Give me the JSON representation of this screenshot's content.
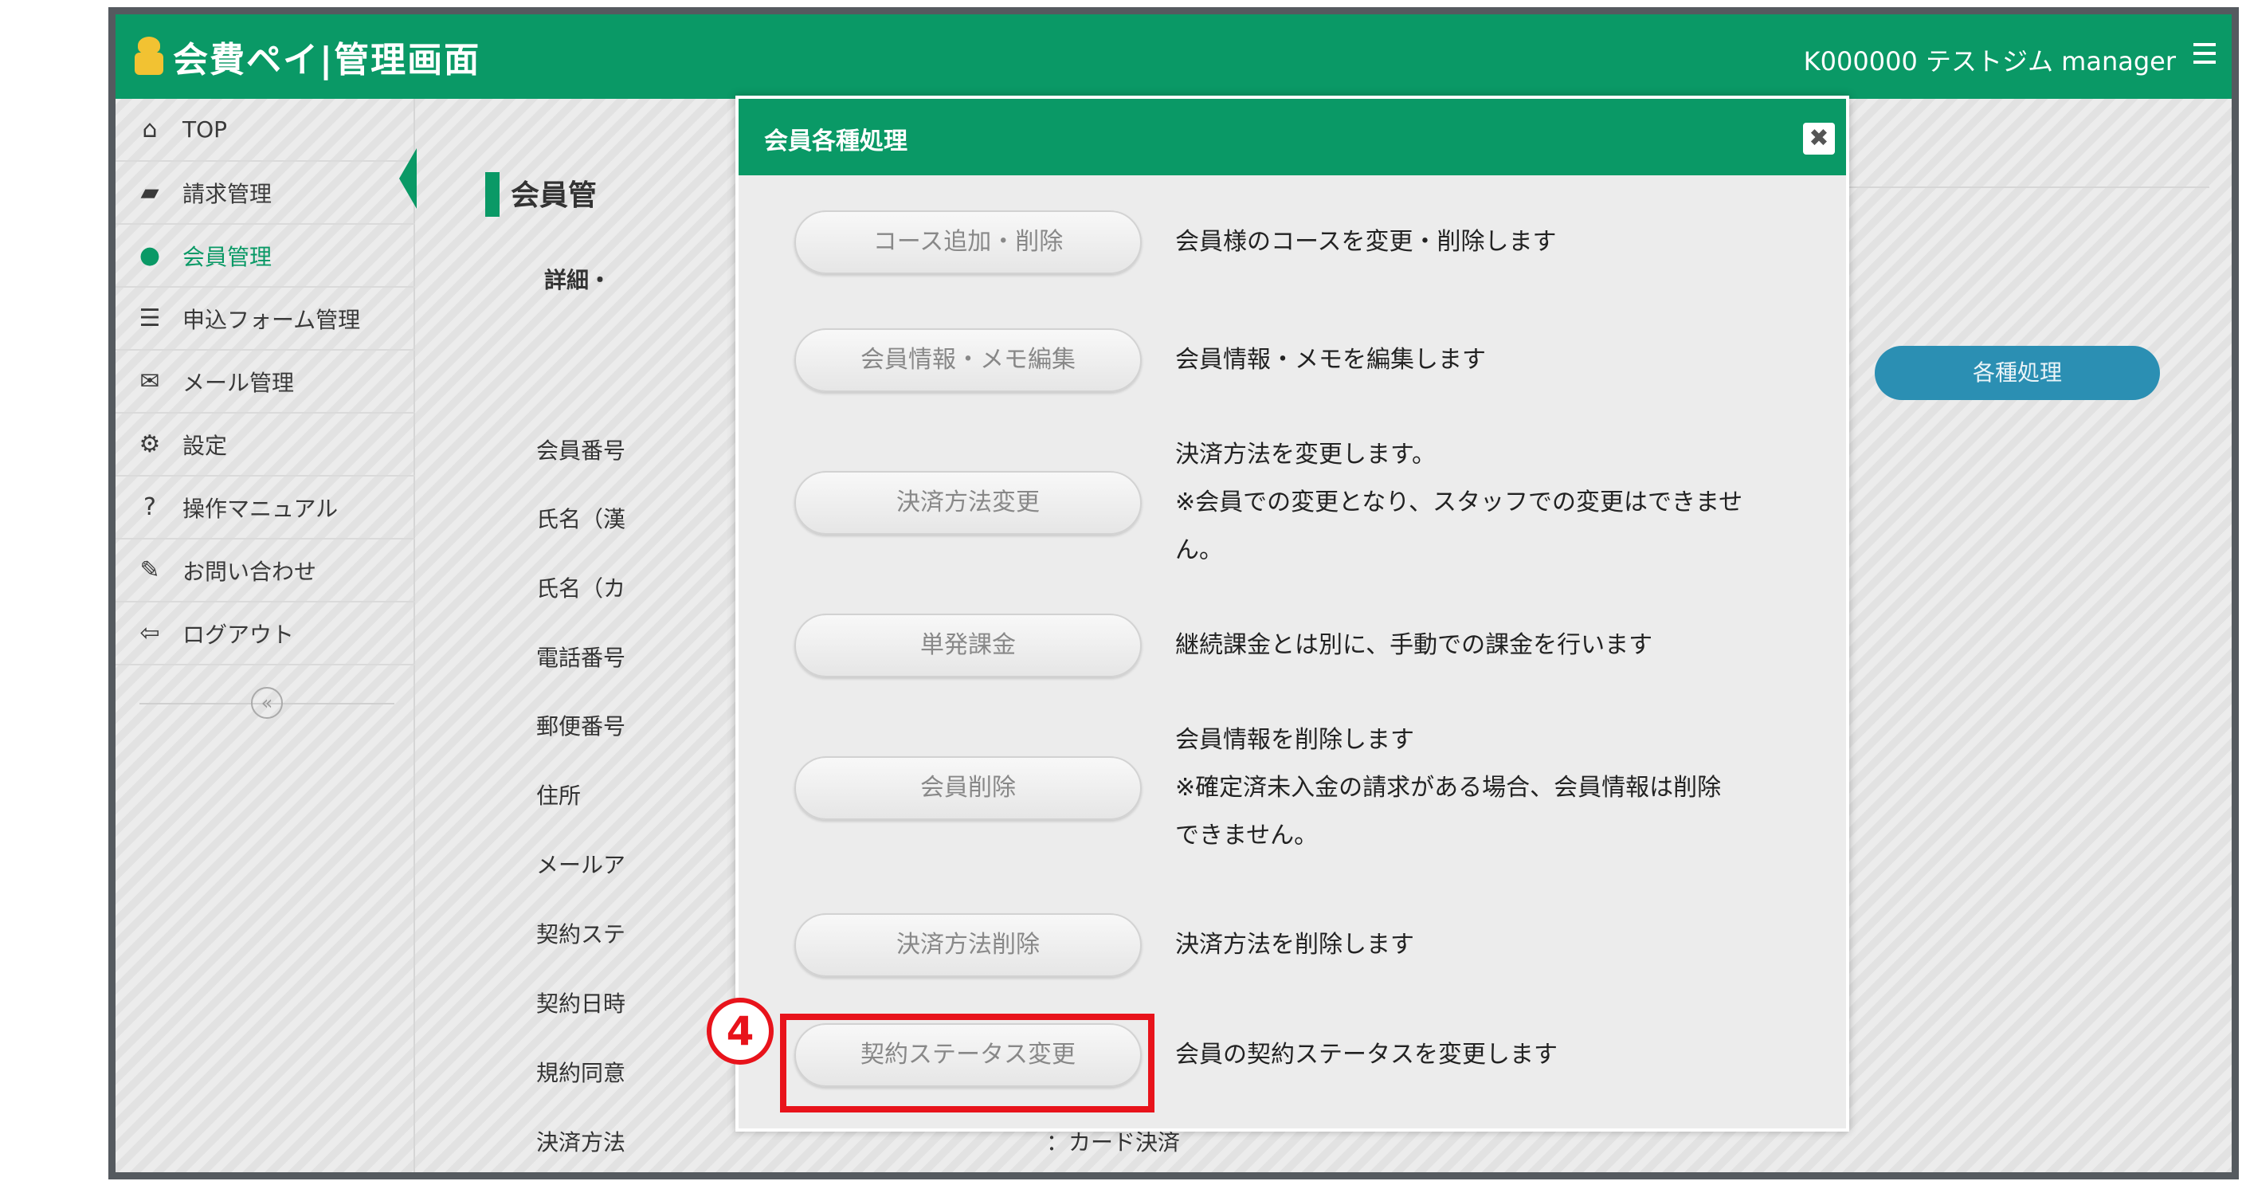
{
  "header": {
    "logo_text": "会費ペイ|管理画面",
    "account": "K000000 テストジム manager",
    "brand_color": "#0a9966"
  },
  "sidebar": {
    "items": [
      {
        "label": "TOP",
        "icon": "home-icon"
      },
      {
        "label": "請求管理",
        "icon": "book-icon"
      },
      {
        "label": "会員管理",
        "icon": "user-icon",
        "active": true
      },
      {
        "label": "申込フォーム管理",
        "icon": "list-icon"
      },
      {
        "label": "メール管理",
        "icon": "envelope-icon"
      },
      {
        "label": "設定",
        "icon": "gears-icon"
      },
      {
        "label": "操作マニュアル",
        "icon": "question-icon"
      },
      {
        "label": "お問い合わせ",
        "icon": "chat-icon"
      },
      {
        "label": "ログアウト",
        "icon": "logout-icon"
      }
    ],
    "collapse_symbol": "«"
  },
  "main": {
    "page_title": "会員管",
    "sub_title": "詳細・",
    "actions_button": "各種処理",
    "fields": [
      "会員番号",
      "氏名（漢",
      "氏名（カ",
      "電話番号",
      "郵便番号",
      "住所",
      "メールア",
      "契約ステ",
      "契約日時",
      "規約同意",
      "決済方法"
    ],
    "payment_value": "：カード決済"
  },
  "modal": {
    "title": "会員各種処理",
    "close_symbol": "✖",
    "actions": [
      {
        "button": "コース追加・削除",
        "description": "会員様のコースを変更・削除します"
      },
      {
        "button": "会員情報・メモ編集",
        "description": "会員情報・メモを編集します"
      },
      {
        "button": "決済方法変更",
        "description": "決済方法を変更します。\n※会員での変更となり、スタッフでの変更はできませ\nん。"
      },
      {
        "button": "単発課金",
        "description": "継続課金とは別に、手動での課金を行います"
      },
      {
        "button": "会員削除",
        "description": "会員情報を削除します\n※確定済未入金の請求がある場合、会員情報は削除\nできません。"
      },
      {
        "button": "決済方法削除",
        "description": "決済方法を削除します"
      },
      {
        "button": "契約ステータス変更",
        "description": "会員の契約ステータスを変更します"
      }
    ]
  },
  "annotation": {
    "step_number": "4",
    "color": "#e8131b"
  }
}
